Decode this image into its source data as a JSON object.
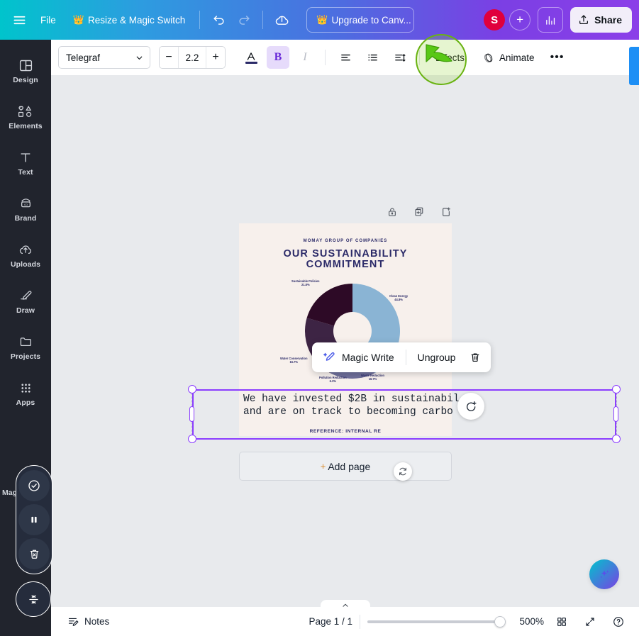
{
  "header": {
    "menu_icon": "hamburger-icon",
    "file_label": "File",
    "resize_label": "Resize & Magic Switch",
    "resize_crown": "👑",
    "undo_icon": "undo-icon",
    "redo_icon": "redo-icon",
    "cloud_icon": "cloud-saved-icon",
    "upgrade_label": "Upgrade to Canv...",
    "upgrade_crown": "👑",
    "avatar_initial": "S",
    "add_collaborator_icon": "plus-icon",
    "stats_icon": "insights-bar-chart-icon",
    "share_label": "Share",
    "share_icon": "upload-share-icon"
  },
  "sidebar": {
    "items": [
      {
        "label": "Design",
        "icon": "design-layout-icon"
      },
      {
        "label": "Elements",
        "icon": "shapes-elements-icon"
      },
      {
        "label": "Text",
        "icon": "text-t-icon"
      },
      {
        "label": "Brand",
        "icon": "brand-kit-icon"
      },
      {
        "label": "Uploads",
        "icon": "upload-cloud-icon"
      },
      {
        "label": "Draw",
        "icon": "draw-pen-icon"
      },
      {
        "label": "Projects",
        "icon": "folder-icon"
      },
      {
        "label": "Apps",
        "icon": "apps-grid-icon"
      }
    ],
    "magic_label": "Mag",
    "magic_buttons": [
      {
        "icon": "check-circle-icon",
        "name": "approve-button"
      },
      {
        "icon": "pause-icon",
        "name": "pause-button"
      },
      {
        "icon": "trash-x-icon",
        "name": "discard-button"
      }
    ],
    "magic_single_icon": "collapse-vertical-icon"
  },
  "toolbar": {
    "font_name": "Telegraf",
    "font_chevron": "chevron-down-icon",
    "size_minus": "−",
    "size_value": "2.2",
    "size_plus": "+",
    "text_color_icon": "font-color-A-icon",
    "bold_label": "B",
    "italic_label": "I",
    "align_icon": "align-text-icon",
    "list_icon": "bullet-list-icon",
    "spacing_icon": "line-spacing-icon",
    "effects_label": "Effects",
    "animate_label": "Animate",
    "animate_icon": "animate-icon",
    "more_label": "•••"
  },
  "canvas": {
    "page_actions": [
      {
        "icon": "lock-icon",
        "name": "lock-page-button"
      },
      {
        "icon": "duplicate-icon",
        "name": "duplicate-page-button"
      },
      {
        "icon": "add-page-icon",
        "name": "insert-page-button"
      }
    ],
    "design": {
      "eyebrow": "MOMAY GROUP OF COMPANIES",
      "title_line1": "OUR SUSTAINABILITY",
      "title_line2": "COMMITMENT",
      "reference": "REFERENCE: INTERNAL RE",
      "bg_color": "#f7f0ec",
      "ink_color": "#2b2a68"
    },
    "selected_text": {
      "line1": "We have invested $2B in sustainabil",
      "line2": "and are on track to becoming carbo",
      "selection_color": "#8b3dff"
    },
    "comment_icon": "add-comment-icon",
    "context_menu": {
      "magic_write_label": "Magic Write",
      "magic_write_icon": "magic-wand-pencil-icon",
      "ungroup_label": "Ungroup",
      "delete_icon": "trash-icon"
    },
    "add_page_label": "Add page",
    "add_page_plus": "+",
    "rotate_icon": "rotate-icon",
    "ai_fab_icon": "sparkle-ai-icon",
    "scroll_up_icon": "chevron-up-icon"
  },
  "chart_data": {
    "type": "pie",
    "title": "OUR SUSTAINABILITY COMMITMENT",
    "donut": true,
    "legend_position": "around-slices",
    "categories": [
      "Clean Energy",
      "Waste Reduction",
      "Pollution Reduction",
      "Water Conservation",
      "Sustainable Policies"
    ],
    "values": [
      44.8,
      16.7,
      6.2,
      16.7,
      21.8
    ],
    "labels": [
      {
        "name": "Clean Energy",
        "pct": "44.8%",
        "color": "#8ab4d4"
      },
      {
        "name": "Waste Reduction",
        "pct": "16.7%",
        "color": "#6f6f9a"
      },
      {
        "name": "Pollution Reduction",
        "pct": "6.2%",
        "color": "#4a3355"
      },
      {
        "name": "Water Conservation",
        "pct": "16.7%",
        "color": "#3d2444"
      },
      {
        "name": "Sustainable Policies",
        "pct": "21.8%",
        "color": "#2d0a26"
      }
    ]
  },
  "bottombar": {
    "notes_label": "Notes",
    "notes_icon": "notes-icon",
    "page_indicator": "Page 1 / 1",
    "zoom_level": "500%",
    "grid_view_icon": "grid-view-icon",
    "fullscreen_icon": "fullscreen-icon",
    "help_icon": "help-question-icon"
  },
  "cursor": {
    "type": "green-click-cursor",
    "target": "Effects"
  }
}
